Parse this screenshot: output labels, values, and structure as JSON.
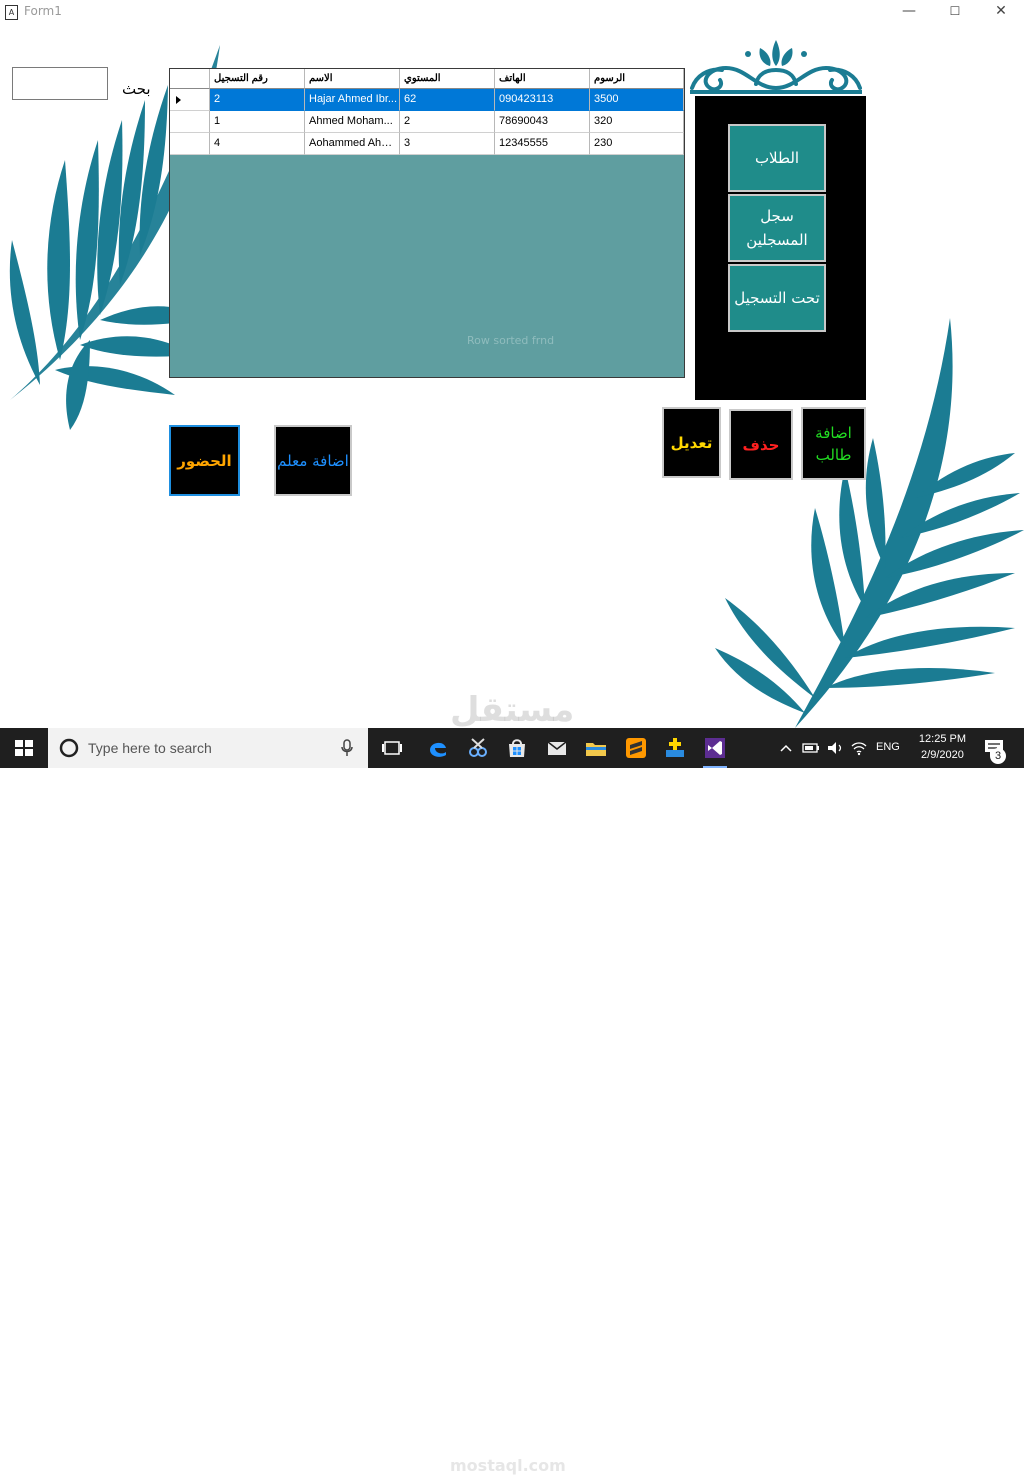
{
  "window": {
    "title": "Form1",
    "icon_letter": "A",
    "minimize": "—",
    "maximize": "☐",
    "close": "✕"
  },
  "search": {
    "label": "بحث",
    "value": ""
  },
  "grid": {
    "columns": [
      "رقم التسجيل",
      "الاسم",
      "المستوي",
      "الهاتف",
      "الرسوم"
    ],
    "rows": [
      [
        "2",
        "Hajar Ahmed Ibr...",
        "62",
        "090423113",
        "3500"
      ],
      [
        "1",
        "Ahmed Moham...",
        "2",
        "78690043",
        "320"
      ],
      [
        "4",
        "Aohammed Ahm...",
        "3",
        "12345555",
        "230"
      ]
    ],
    "selected_row": 0,
    "faint_text": "Row sorted frnd"
  },
  "menu": {
    "students": "الطلاب",
    "registered_log": "سجل المسجلين",
    "under_registration": "تحت التسجيل"
  },
  "actions": {
    "attendance": "الحضور",
    "add_teacher": "اضافة معلم",
    "edit": "تعديل",
    "delete": "حذف",
    "add_student": "اضافة طالب"
  },
  "colors": {
    "attendance": "#ffa500",
    "add_teacher": "#1e90ff",
    "edit": "#ffd700",
    "delete": "#ff2020",
    "add_student": "#22dd22",
    "menu_button": "#1f8c8a",
    "grid_background": "#5f9ea0",
    "selection": "#0078d7",
    "leaf": "#1b7c93"
  },
  "taskbar": {
    "search_placeholder": "Type here to search",
    "time": "12:25 PM",
    "date": "2/9/2020",
    "language": "ENG",
    "notification_count": "3"
  },
  "watermark": {
    "text": "مستقل",
    "sub": "mostaql.com"
  }
}
